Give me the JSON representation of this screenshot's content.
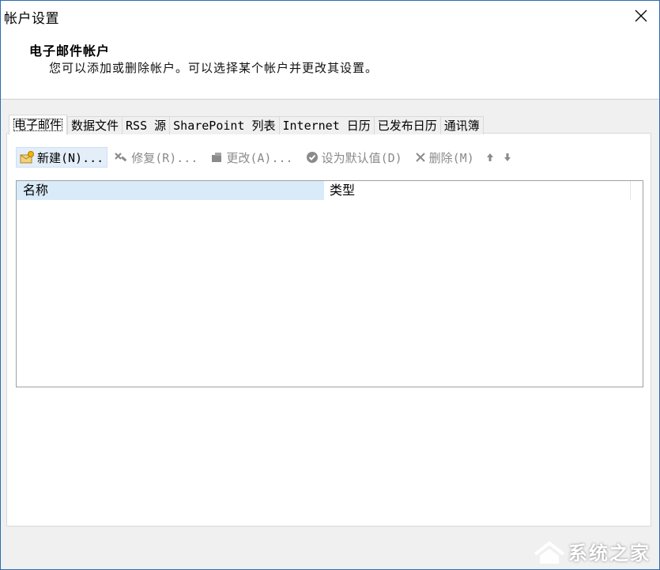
{
  "window": {
    "title": "帐户设置"
  },
  "header": {
    "title": "电子邮件帐户",
    "description": "您可以添加或删除帐户。可以选择某个帐户并更改其设置。"
  },
  "tabs": [
    {
      "label": "电子邮件",
      "active": true
    },
    {
      "label": "数据文件"
    },
    {
      "label": "RSS 源"
    },
    {
      "label": "SharePoint 列表"
    },
    {
      "label": "Internet 日历"
    },
    {
      "label": "已发布日历"
    },
    {
      "label": "通讯簿"
    }
  ],
  "toolbar": {
    "new": "新建(N)...",
    "repair": "修复(R)...",
    "change": "更改(A)...",
    "set_default": "设为默认值(D)",
    "remove": "删除(M)"
  },
  "list": {
    "columns": [
      "名称",
      "类型"
    ],
    "rows": []
  },
  "watermark": {
    "text": "系统之家"
  },
  "colors": {
    "window_border": "#2b6cb0",
    "selected_header": "#d9ebf9",
    "disabled_text": "#8a8a8a"
  }
}
